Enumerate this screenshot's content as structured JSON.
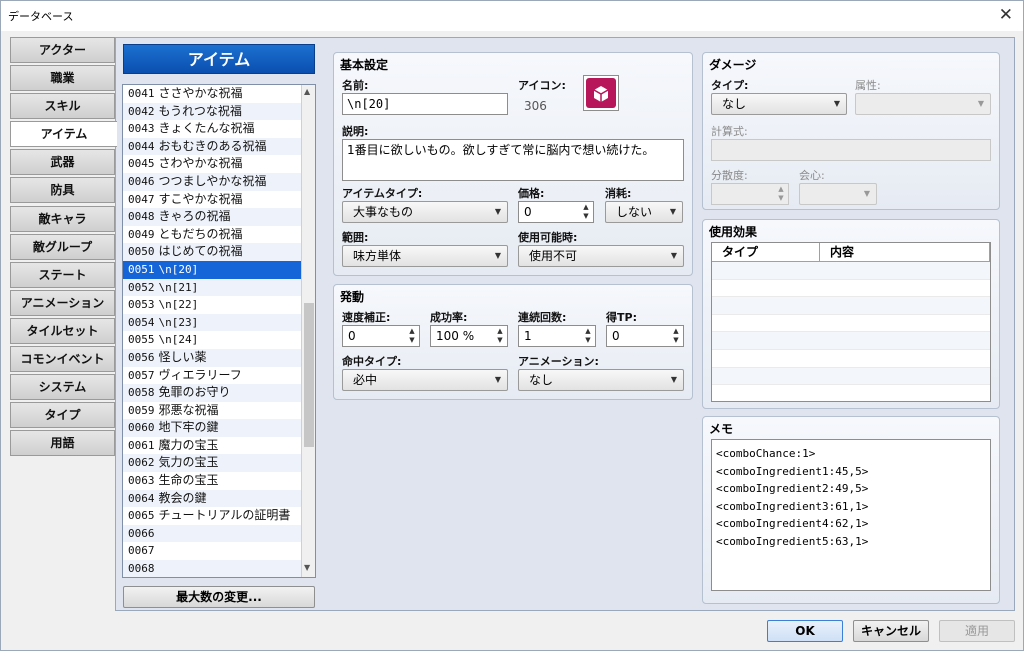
{
  "window": {
    "title": "データベース",
    "close_label": "✕"
  },
  "categories": [
    "アクター",
    "職業",
    "スキル",
    "アイテム",
    "武器",
    "防具",
    "敵キャラ",
    "敵グループ",
    "ステート",
    "アニメーション",
    "タイルセット",
    "コモンイベント",
    "システム",
    "タイプ",
    "用語"
  ],
  "list": {
    "header": "アイテム",
    "items": [
      {
        "id": "0041",
        "name": "ささやかな祝福"
      },
      {
        "id": "0042",
        "name": "もうれつな祝福"
      },
      {
        "id": "0043",
        "name": "きょくたんな祝福"
      },
      {
        "id": "0044",
        "name": "おもむきのある祝福"
      },
      {
        "id": "0045",
        "name": "さわやかな祝福"
      },
      {
        "id": "0046",
        "name": "つつましやかな祝福"
      },
      {
        "id": "0047",
        "name": "すこやかな祝福"
      },
      {
        "id": "0048",
        "name": "きゃろの祝福"
      },
      {
        "id": "0049",
        "name": "ともだちの祝福"
      },
      {
        "id": "0050",
        "name": "はじめての祝福"
      },
      {
        "id": "0051",
        "name": "\\n[20]"
      },
      {
        "id": "0052",
        "name": "\\n[21]"
      },
      {
        "id": "0053",
        "name": "\\n[22]"
      },
      {
        "id": "0054",
        "name": "\\n[23]"
      },
      {
        "id": "0055",
        "name": "\\n[24]"
      },
      {
        "id": "0056",
        "name": "怪しい薬"
      },
      {
        "id": "0057",
        "name": "ヴィエラリーフ"
      },
      {
        "id": "0058",
        "name": "免罪のお守り"
      },
      {
        "id": "0059",
        "name": "邪悪な祝福"
      },
      {
        "id": "0060",
        "name": "地下牢の鍵"
      },
      {
        "id": "0061",
        "name": "魔力の宝玉"
      },
      {
        "id": "0062",
        "name": "気力の宝玉"
      },
      {
        "id": "0063",
        "name": "生命の宝玉"
      },
      {
        "id": "0064",
        "name": "教会の鍵"
      },
      {
        "id": "0065",
        "name": "チュートリアルの証明書"
      },
      {
        "id": "0066",
        "name": ""
      },
      {
        "id": "0067",
        "name": ""
      },
      {
        "id": "0068",
        "name": ""
      }
    ],
    "max_button": "最大数の変更..."
  },
  "basic": {
    "title": "基本設定",
    "name_label": "名前:",
    "name_value": "\\n[20]",
    "icon_label": "アイコン:",
    "icon_index": "306",
    "desc_label": "説明:",
    "desc_value": "1番目に欲しいもの。欲しすぎて常に脳内で想い続けた。",
    "itemtype_label": "アイテムタイプ:",
    "itemtype_value": "大事なもの",
    "price_label": "価格:",
    "price_value": "0",
    "consume_label": "消耗:",
    "consume_value": "しない",
    "scope_label": "範囲:",
    "scope_value": "味方単体",
    "occasion_label": "使用可能時:",
    "occasion_value": "使用不可"
  },
  "invocation": {
    "title": "発動",
    "speed_label": "速度補正:",
    "speed_value": "0",
    "success_label": "成功率:",
    "success_value": "100 %",
    "repeat_label": "連続回数:",
    "repeat_value": "1",
    "tp_label": "得TP:",
    "tp_value": "0",
    "hittype_label": "命中タイプ:",
    "hittype_value": "必中",
    "anim_label": "アニメーション:",
    "anim_value": "なし"
  },
  "damage": {
    "title": "ダメージ",
    "type_label": "タイプ:",
    "type_value": "なし",
    "element_label": "属性:",
    "formula_label": "計算式:",
    "variance_label": "分散度:",
    "critical_label": "会心:"
  },
  "effects": {
    "title": "使用効果",
    "col_type": "タイプ",
    "col_content": "内容"
  },
  "memo": {
    "title": "メモ",
    "lines": [
      "<comboChance:1>",
      "<comboIngredient1:45,5>",
      "<comboIngredient2:49,5>",
      "<comboIngredient3:61,1>",
      "<comboIngredient4:62,1>",
      "<comboIngredient5:63,1>"
    ]
  },
  "buttons": {
    "ok": "OK",
    "cancel": "キャンセル",
    "apply": "適用"
  },
  "colors": {
    "accent": "#1565d8",
    "icon": "#b8165a"
  }
}
